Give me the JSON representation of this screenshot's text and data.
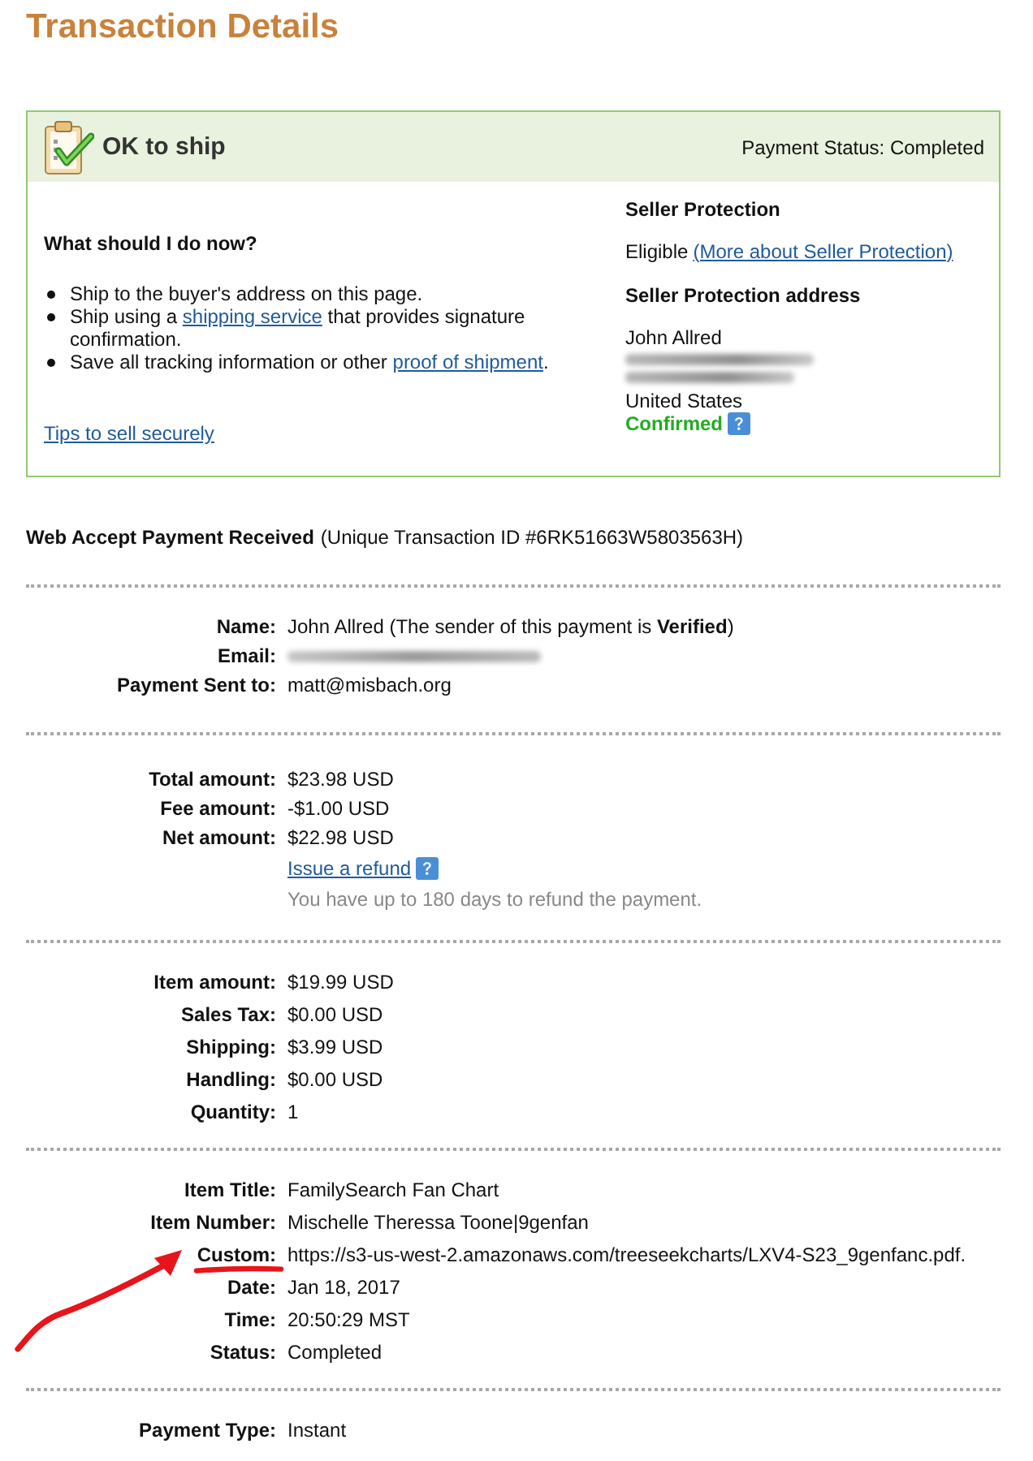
{
  "page_title": "Transaction Details",
  "status_box": {
    "title": "OK to ship",
    "payment_status": "Payment Status: Completed",
    "guidance": {
      "heading": "What should I do now?",
      "steps": [
        [
          {
            "kind": "text",
            "text": "Ship to the buyer's address on this page."
          }
        ],
        [
          {
            "kind": "text",
            "text": "Ship using a "
          },
          {
            "kind": "link",
            "text": "shipping service"
          },
          {
            "kind": "text",
            "text": " that provides signature confirmation."
          }
        ],
        [
          {
            "kind": "text",
            "text": "Save all tracking information or other "
          },
          {
            "kind": "link",
            "text": "proof of shipment"
          },
          {
            "kind": "text",
            "text": "."
          }
        ]
      ],
      "tips_link": "Tips to sell securely"
    },
    "seller_protection": {
      "heading": "Seller Protection",
      "status": "Eligible",
      "more_link": "(More about Seller Protection)",
      "address_heading": "Seller Protection address",
      "address_name": "John Allred",
      "address_country": "United States",
      "address_status": "Confirmed"
    }
  },
  "transaction": {
    "type": "Web Accept Payment Received",
    "id_note": "(Unique Transaction ID #6RK51663W5803563H)"
  },
  "sections": [
    {
      "rows": [
        {
          "kind": "text",
          "label": "Name:",
          "value": "John Allred (The sender of this payment is **Verified**)"
        },
        {
          "kind": "redacted",
          "label": "Email:"
        },
        {
          "kind": "text",
          "label": "Payment Sent to:",
          "value": "matt@misbach.org"
        }
      ]
    },
    {
      "rows": [
        {
          "kind": "text",
          "label": "Total amount:",
          "value": "$23.98 USD"
        },
        {
          "kind": "text",
          "label": "Fee amount:",
          "value": "-$1.00 USD"
        },
        {
          "kind": "text",
          "label": "Net amount:",
          "value": "$22.98 USD"
        },
        {
          "kind": "refund",
          "link": "Issue a refund",
          "note": "You have up to 180 days to refund the payment."
        }
      ]
    },
    {
      "rows": [
        {
          "kind": "text",
          "label": "Item amount:",
          "value": "$19.99 USD"
        },
        {
          "kind": "text",
          "label": "Sales Tax:",
          "value": "$0.00 USD"
        },
        {
          "kind": "text",
          "label": "Shipping:",
          "value": "$3.99 USD"
        },
        {
          "kind": "text",
          "label": "Handling:",
          "value": "$0.00 USD"
        },
        {
          "kind": "text",
          "label": "Quantity:",
          "value": "1"
        }
      ]
    },
    {
      "rows": [
        {
          "kind": "text",
          "label": "Item Title:",
          "value": "FamilySearch Fan Chart"
        },
        {
          "kind": "text",
          "label": "Item Number:",
          "value": "Mischelle Theressa Toone|9genfan"
        },
        {
          "kind": "text",
          "label": "Custom:",
          "value": "https://s3-us-west-2.amazonaws.com/treeseekcharts/LXV4-S23_9genfanc.pdf.",
          "annotated": true
        },
        {
          "kind": "text",
          "label": "Date:",
          "value": "Jan 18, 2017"
        },
        {
          "kind": "text",
          "label": "Time:",
          "value": "20:50:29 MST"
        },
        {
          "kind": "text",
          "label": "Status:",
          "value": "Completed"
        }
      ]
    },
    {
      "rows": [
        {
          "kind": "text",
          "label": "Payment Type:",
          "value": "Instant"
        }
      ]
    }
  ]
}
